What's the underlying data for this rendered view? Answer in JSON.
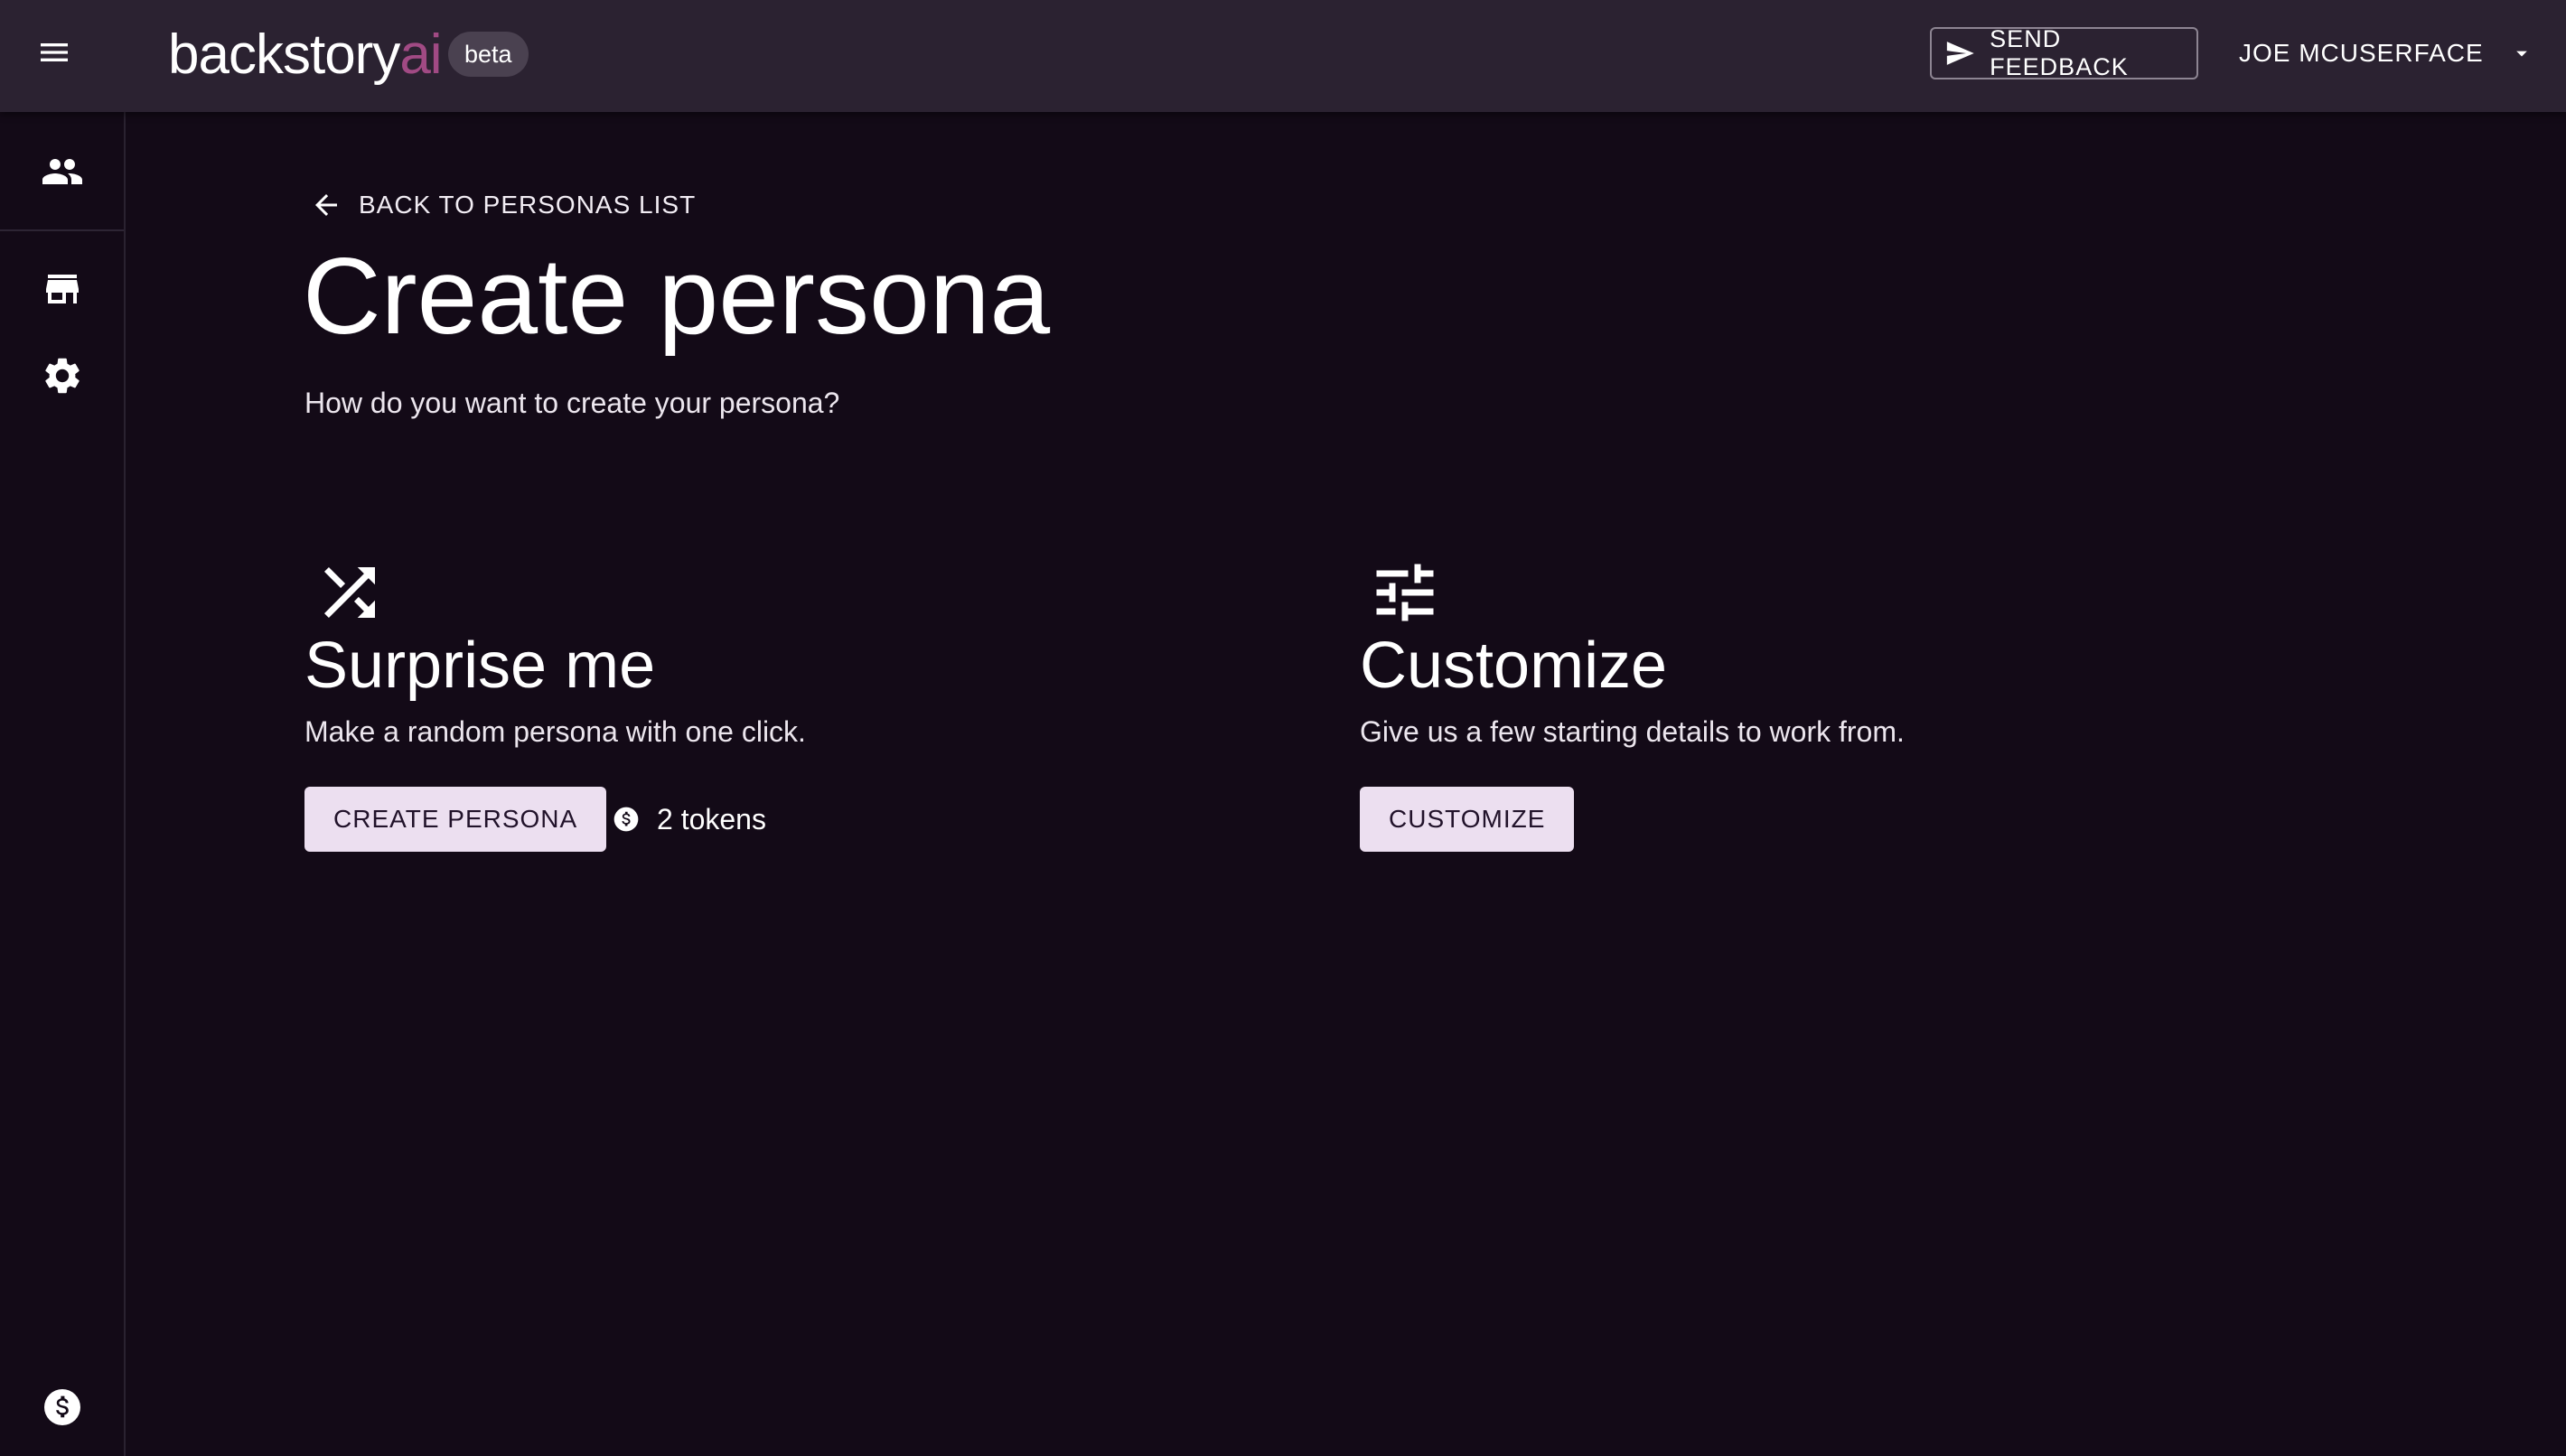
{
  "header": {
    "logo_main": "backstory",
    "logo_accent": "ai",
    "badge": "beta",
    "feedback_label": "SEND FEEDBACK",
    "user_name": "JOE MCUSERFACE"
  },
  "sidebar": {
    "items": [
      {
        "icon": "people-icon"
      },
      {
        "icon": "store-icon"
      },
      {
        "icon": "gear-icon"
      },
      {
        "icon": "token-icon"
      }
    ]
  },
  "main": {
    "back_label": "BACK TO PERSONAS LIST",
    "title": "Create persona",
    "subtitle": "How do you want to create your persona?",
    "options": [
      {
        "icon": "shuffle-icon",
        "title": "Surprise me",
        "description": "Make a random persona with one click.",
        "button_label": "CREATE PERSONA",
        "cost_label": "2 tokens"
      },
      {
        "icon": "tune-icon",
        "title": "Customize",
        "description": "Give us a few starting details to work from.",
        "button_label": "CUSTOMIZE"
      }
    ]
  },
  "colors": {
    "background": "#130a17",
    "topbar": "#2b2231",
    "accent": "#a14a84",
    "button": "#ecdff0"
  }
}
